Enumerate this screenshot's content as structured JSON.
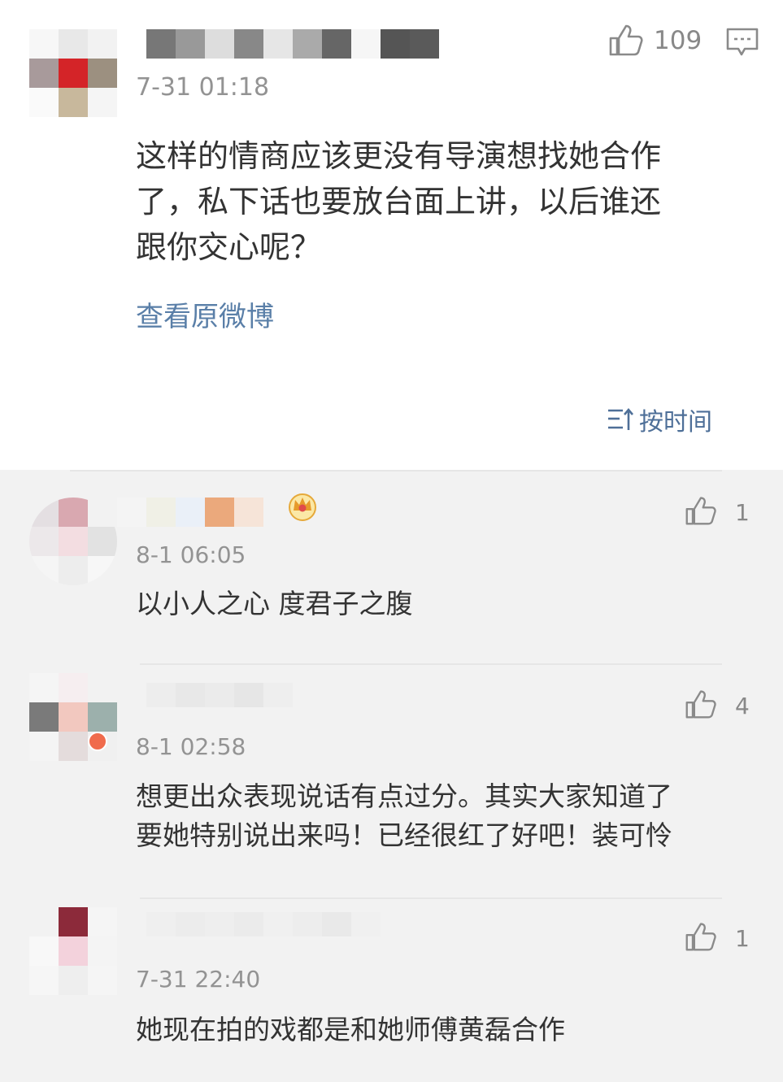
{
  "main_comment": {
    "like_count": "109",
    "time": "7-31 01:18",
    "text_lines": [
      "这样的情商应该更没有导演想找她合作",
      "了，私下话也要放台面上讲，以后谁还",
      "跟你交心呢？"
    ],
    "view_original": "查看原微博",
    "sort_label": "按时间"
  },
  "replies": [
    {
      "time": "8-1 06:05",
      "like_count": "1",
      "text_lines": [
        "以小人之心 度君子之腹"
      ]
    },
    {
      "time": "8-1 02:58",
      "like_count": "4",
      "text_lines": [
        "想更出众表现说话有点过分。其实大家知道了",
        "要她特别说出来吗！已经很红了好吧！装可怜"
      ]
    },
    {
      "time": "7-31 22:40",
      "like_count": "1",
      "text_lines": [
        "她现在拍的戏都是和她师傅黄磊合作"
      ]
    }
  ],
  "colors": {
    "link": "#5a7fa8",
    "sort": "#4e6f98",
    "muted": "#939393",
    "text": "#333333",
    "reply_bg": "#f2f2f2"
  },
  "icons": [
    "thumbs-up-icon",
    "comment-icon",
    "sort-icon",
    "crown-badge-icon"
  ]
}
